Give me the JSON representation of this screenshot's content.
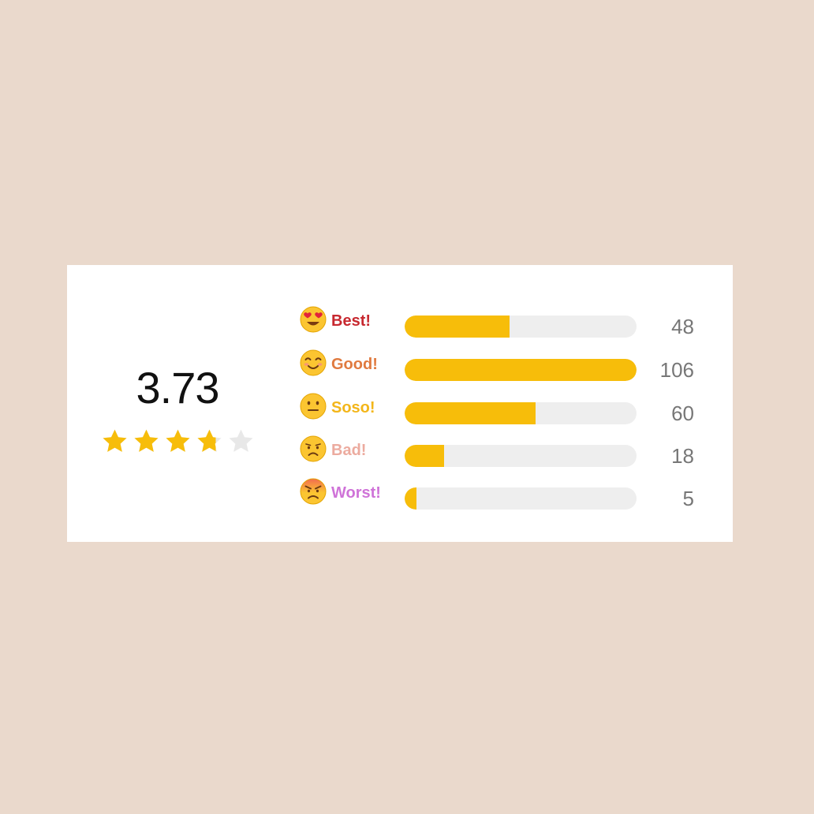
{
  "rating": {
    "average": "3.73",
    "stars": 3.73,
    "max_stars": 5,
    "star_color": "#f7bd0a",
    "star_empty_color": "#e8e8e8"
  },
  "bar_color": "#f7bd0a",
  "track_color": "#eeeeee",
  "rows": [
    {
      "icon": "heart-eyes-emoji-icon",
      "label": "Best!",
      "label_color": "#c7282f",
      "count": "48",
      "value": 48
    },
    {
      "icon": "smiling-emoji-icon",
      "label": "Good!",
      "label_color": "#e07a3f",
      "count": "106",
      "value": 106
    },
    {
      "icon": "neutral-emoji-icon",
      "label": "Soso!",
      "label_color": "#f3b61a",
      "count": "60",
      "value": 60
    },
    {
      "icon": "sad-emoji-icon",
      "label": "Bad!",
      "label_color": "#ecab9f",
      "count": "18",
      "value": 18
    },
    {
      "icon": "angry-emoji-icon",
      "label": "Worst!",
      "label_color": "#cf73d8",
      "count": "5",
      "value": 5
    }
  ]
}
